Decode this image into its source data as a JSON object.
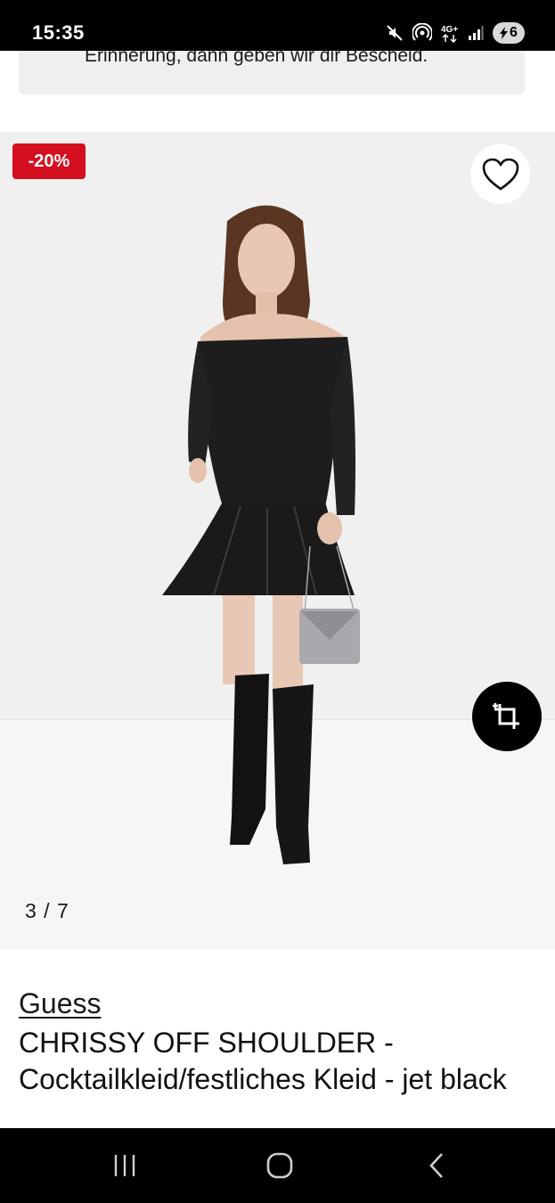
{
  "status_bar": {
    "time": "15:35",
    "battery_level": "6",
    "network": "4G+"
  },
  "banner": {
    "text": "Erinnerung, dann geben wir dir Bescheid."
  },
  "gallery": {
    "discount_badge": "-20%",
    "pager": "3 / 7"
  },
  "product": {
    "brand": "Guess",
    "name": "CHRISSY OFF SHOULDER - Cocktailkleid/festliches Kleid - jet black"
  },
  "colors": {
    "discount_red": "#d40f1f",
    "status_bar": "#000000",
    "image_bg": "#f0f0f0"
  },
  "icons": {
    "status": [
      "mute-icon",
      "hotspot-icon",
      "network-4g-icon",
      "signal-icon",
      "battery-charging-icon"
    ],
    "gallery": [
      "heart-icon",
      "crop-icon"
    ],
    "nav": [
      "recents-icon",
      "home-icon",
      "back-icon"
    ]
  }
}
